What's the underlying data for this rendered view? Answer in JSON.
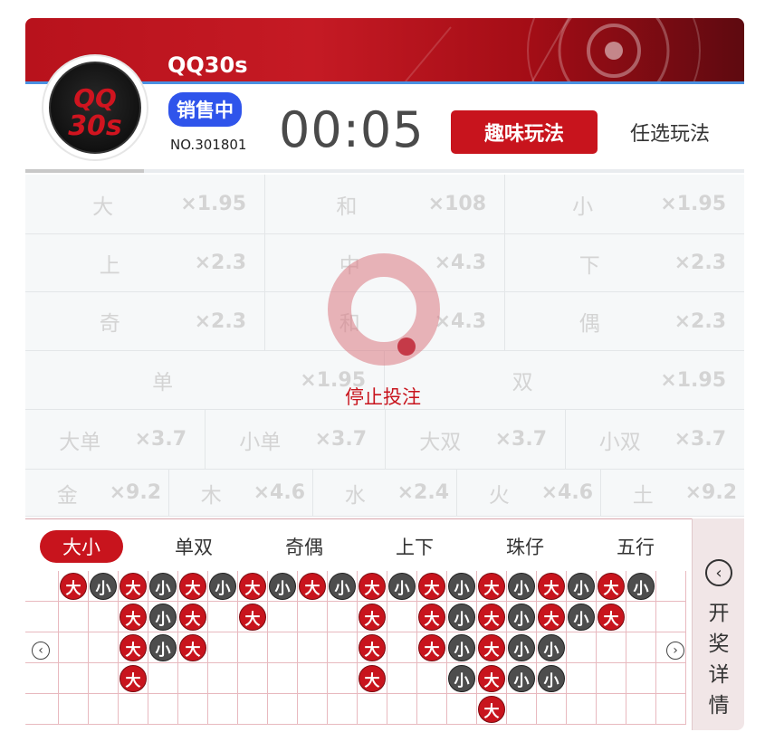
{
  "header": {
    "logo_line1": "QQ",
    "logo_line2": "30s",
    "title": "QQ30s",
    "status": "销售中",
    "issue": "NO.301801",
    "countdown": "00:05",
    "tab_fun": "趣味玩法",
    "tab_free": "任选玩法"
  },
  "bets": {
    "row1": [
      {
        "name": "大",
        "odds": "×1.95"
      },
      {
        "name": "和",
        "odds": "×108"
      },
      {
        "name": "小",
        "odds": "×1.95"
      }
    ],
    "row2": [
      {
        "name": "上",
        "odds": "×2.3"
      },
      {
        "name": "中",
        "odds": "×4.3"
      },
      {
        "name": "下",
        "odds": "×2.3"
      }
    ],
    "row3": [
      {
        "name": "奇",
        "odds": "×2.3"
      },
      {
        "name": "和",
        "odds": "×4.3"
      },
      {
        "name": "偶",
        "odds": "×2.3"
      }
    ],
    "row4": [
      {
        "name": "单",
        "odds": "×1.95"
      },
      {
        "name": "双",
        "odds": "×1.95"
      }
    ],
    "row5": [
      {
        "name": "大单",
        "odds": "×3.7"
      },
      {
        "name": "小单",
        "odds": "×3.7"
      },
      {
        "name": "大双",
        "odds": "×3.7"
      },
      {
        "name": "小双",
        "odds": "×3.7"
      }
    ],
    "row6": [
      {
        "name": "金",
        "odds": "×9.2"
      },
      {
        "name": "木",
        "odds": "×4.6"
      },
      {
        "name": "水",
        "odds": "×2.4"
      },
      {
        "name": "火",
        "odds": "×4.6"
      },
      {
        "name": "土",
        "odds": "×9.2"
      }
    ]
  },
  "overlay": {
    "text": "停止投注"
  },
  "trend": {
    "tabs": [
      "大小",
      "单双",
      "奇偶",
      "上下",
      "珠仔",
      "五行"
    ],
    "active_tab": "大小",
    "big_label": "大",
    "small_label": "小",
    "columns": [
      [
        "大"
      ],
      [
        "小"
      ],
      [
        "大",
        "大",
        "大",
        "大"
      ],
      [
        "小",
        "小",
        "小"
      ],
      [
        "大",
        "大",
        "大"
      ],
      [
        "小"
      ],
      [
        "大",
        "大"
      ],
      [
        "小"
      ],
      [
        "大"
      ],
      [
        "小"
      ],
      [
        "大",
        "大",
        "大",
        "大"
      ],
      [
        "小"
      ],
      [
        "大",
        "大",
        "大"
      ],
      [
        "小",
        "小",
        "小",
        "小"
      ],
      [
        "大",
        "大",
        "大",
        "大",
        "大"
      ],
      [
        "小",
        "小",
        "小",
        "小"
      ],
      [
        "大",
        "大",
        "小",
        "小"
      ],
      [
        "小",
        "小"
      ],
      [
        "大",
        "大"
      ],
      [
        "小"
      ]
    ],
    "side_label": [
      "开",
      "奖",
      "详",
      "情"
    ]
  },
  "icons": {
    "prev": "chevron-left-icon",
    "next": "chevron-right-icon",
    "details": "chevron-left-circle-icon"
  },
  "colors": {
    "brand_red": "#c8141d",
    "badge_blue": "#2f54eb",
    "ball_small": "#4d4d4d"
  }
}
